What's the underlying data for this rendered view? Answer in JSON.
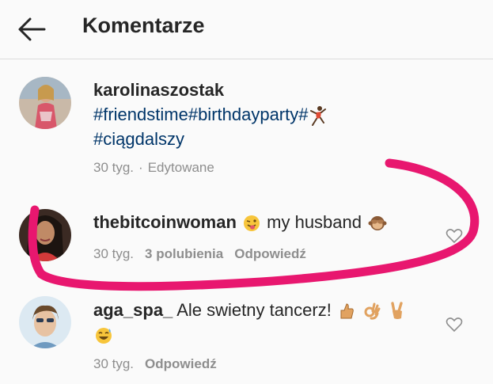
{
  "header": {
    "title": "Komentarze"
  },
  "comments": [
    {
      "username": "karolinaszostak",
      "tags_line1": "#friendstime#birthdayparty#",
      "tags_line2": "#ciągdalszy",
      "time": "30 tyg.",
      "separator": "·",
      "edited": "Edytowane"
    },
    {
      "username": "thebitcoinwoman",
      "text": "my husband",
      "time": "30 tyg.",
      "likes": "3 polubienia",
      "reply": "Odpowiedź"
    },
    {
      "username": "aga_spa_",
      "text": "Ale swietny tancerz!",
      "time": "30 tyg.",
      "reply": "Odpowiedź"
    }
  ],
  "colors": {
    "hashtag": "#003569",
    "annotation": "#e8176f",
    "meta": "#8e8e8e"
  }
}
